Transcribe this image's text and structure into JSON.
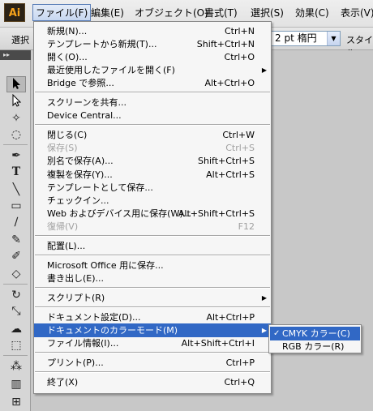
{
  "app": {
    "logo": "Ai"
  },
  "menubar": {
    "items": [
      {
        "label": "ファイル(F)",
        "active": true
      },
      {
        "label": "編集(E)"
      },
      {
        "label": "オブジェクト(O)"
      },
      {
        "label": "書式(T)"
      },
      {
        "label": "選択(S)"
      },
      {
        "label": "効果(C)"
      },
      {
        "label": "表示(V)"
      }
    ]
  },
  "controlbar": {
    "select_label": "選択",
    "font_value": "2 pt 楕円",
    "style_label": "スタイル"
  },
  "tools_panel": {
    "header": "▸▸"
  },
  "file_menu": {
    "items": [
      {
        "label": "新規(N)...",
        "shortcut": "Ctrl+N"
      },
      {
        "label": "テンプレートから新規(T)...",
        "shortcut": "Shift+Ctrl+N"
      },
      {
        "label": "開く(O)...",
        "shortcut": "Ctrl+O"
      },
      {
        "label": "最近使用したファイルを開く(F)",
        "submenu": true
      },
      {
        "label": "Bridge で参照...",
        "shortcut": "Alt+Ctrl+O"
      },
      {
        "sep": true
      },
      {
        "label": "スクリーンを共有..."
      },
      {
        "label": "Device Central..."
      },
      {
        "sep": true
      },
      {
        "label": "閉じる(C)",
        "shortcut": "Ctrl+W"
      },
      {
        "label": "保存(S)",
        "shortcut": "Ctrl+S",
        "disabled": true
      },
      {
        "label": "別名で保存(A)...",
        "shortcut": "Shift+Ctrl+S"
      },
      {
        "label": "複製を保存(Y)...",
        "shortcut": "Alt+Ctrl+S"
      },
      {
        "label": "テンプレートとして保存..."
      },
      {
        "label": "チェックイン..."
      },
      {
        "label": "Web およびデバイス用に保存(W)...",
        "shortcut": "Alt+Shift+Ctrl+S"
      },
      {
        "label": "復帰(V)",
        "shortcut": "F12",
        "disabled": true
      },
      {
        "sep": true
      },
      {
        "label": "配置(L)..."
      },
      {
        "sep": true
      },
      {
        "label": "Microsoft Office 用に保存..."
      },
      {
        "label": "書き出し(E)..."
      },
      {
        "sep": true
      },
      {
        "label": "スクリプト(R)",
        "submenu": true
      },
      {
        "sep": true
      },
      {
        "label": "ドキュメント設定(D)...",
        "shortcut": "Alt+Ctrl+P"
      },
      {
        "label": "ドキュメントのカラーモード(M)",
        "submenu": true,
        "highlighted": true
      },
      {
        "label": "ファイル情報(I)...",
        "shortcut": "Alt+Shift+Ctrl+I"
      },
      {
        "sep": true
      },
      {
        "label": "プリント(P)...",
        "shortcut": "Ctrl+P"
      },
      {
        "sep": true
      },
      {
        "label": "終了(X)",
        "shortcut": "Ctrl+Q"
      }
    ]
  },
  "color_mode_submenu": {
    "items": [
      {
        "label": "CMYK カラー(C)",
        "checked": true,
        "highlighted": true
      },
      {
        "label": "RGB カラー(R)"
      }
    ],
    "check_glyph": "✓"
  },
  "colors": {
    "highlight": "#3168c5",
    "menu_bg": "#f6f6f6",
    "disabled": "#a0a0a0"
  }
}
